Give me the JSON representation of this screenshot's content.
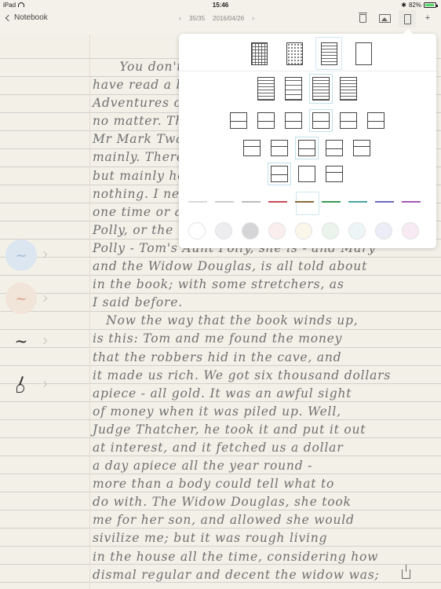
{
  "status_bar": {
    "device": "iPad",
    "time": "15:46",
    "bluetooth": "✱",
    "battery": "82%"
  },
  "toolbar": {
    "back_label": "Notebook",
    "page_count": "35/35",
    "page_date": "2016/04/26",
    "prev_arrow": "‹",
    "next_arrow": "›",
    "add_label": "+"
  },
  "handwriting": {
    "lines": [
      "      You don't know about me without you",
      "have read a book by the name of The",
      "Adventures of Tom Sawyer; but that ain't",
      "no matter. That book was made by",
      "Mr Mark Twain, and he told the truth,",
      "mainly. There was things which he stretched,",
      "but mainly he told the truth. That is",
      "nothing. I never seen anybody but lied",
      "one time or another, without it was Aunt",
      "Polly, or the widow, or maybe Mary. Aunt",
      "Polly - Tom's Aunt Polly, she is - and Mary",
      "and the Widow Douglas, is all told about",
      "in the book; with some stretchers, as",
      "I said before.",
      "   Now the way that the book winds up,",
      "is this: Tom and me found the money",
      "that the robbers hid in the cave, and",
      "it made us rich. We got six thousand dollars",
      "apiece - all gold. It was an awful sight",
      "of money when it was piled up. Well,",
      "Judge Thatcher, he took it and put it out",
      "at interest, and it fetched us a dollar",
      "a day apiece all the year round -",
      "more than a body could tell what to",
      "do with. The Widow Douglas, she took",
      "me for her son, and allowed she would",
      "sivilize me; but it was rough living",
      "in the house all the time, considering how",
      "dismal regular and decent the widow was;"
    ]
  },
  "pens": [
    {
      "name": "blue-pen",
      "color": "#9fb6cf"
    },
    {
      "name": "orange-pen",
      "color": "#d49a80"
    },
    {
      "name": "black-pen",
      "color": "#222222"
    },
    {
      "name": "brush-pen",
      "color": "#333333"
    }
  ],
  "popover": {
    "ink_colors": [
      "#d9d9d9",
      "#cccccc",
      "#bbbbbb",
      "#c94a56",
      "#8a6a3a",
      "#3a9a55",
      "#4aa5a0",
      "#6a6abf",
      "#a25ab3"
    ],
    "paper_colors": [
      "#ffffff",
      "#ededf0",
      "#d5d5d8",
      "#fbeeee",
      "#fbf6ea",
      "#eaf3ec",
      "#edf5f6",
      "#ecedf7",
      "#f8eaf3"
    ]
  }
}
